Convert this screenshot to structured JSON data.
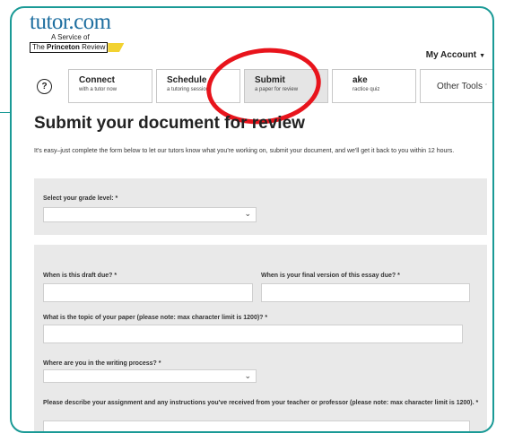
{
  "brand": {
    "logo_word": "tutor.com",
    "tagline": "A Service of",
    "partner_prefix": "The ",
    "partner_bold": "Princeton",
    "partner_suffix": " Review"
  },
  "header": {
    "account_label": "My Account"
  },
  "help": {
    "glyph": "?"
  },
  "tabs": [
    {
      "title": "Connect",
      "subtitle": "with a tutor now"
    },
    {
      "title": "Schedule",
      "subtitle": "a tutoring session"
    },
    {
      "title": "Submit",
      "subtitle": "a paper for review"
    },
    {
      "title": "ake",
      "subtitle": "ractice quiz"
    },
    {
      "title": "Other Tools",
      "subtitle": ""
    }
  ],
  "page": {
    "title": "Submit your document for review",
    "intro": "It's easy–just complete the form below to let our tutors know what you're working on, submit your document, and we'll get it back to you within 12 hours."
  },
  "form": {
    "grade_label": "Select your grade level: *",
    "grade_value": "",
    "draft_due_label": "When is this draft due? *",
    "draft_due_value": "",
    "final_due_label": "When is your final version of this essay due? *",
    "final_due_value": "",
    "topic_label": "What is the topic of your paper (please note: max character limit is 1200)? *",
    "topic_value": "",
    "process_label": "Where are you in the writing process? *",
    "process_value": "",
    "assignment_label": "Please describe your assignment and any instructions you've received from your teacher or professor (please note: max character limit is 1200). *",
    "assignment_value": ""
  },
  "colors": {
    "frame": "#1a9a96",
    "annotation": "#e8141c",
    "brand_blue": "#1f6fa0",
    "brand_yellow": "#f2d231"
  }
}
